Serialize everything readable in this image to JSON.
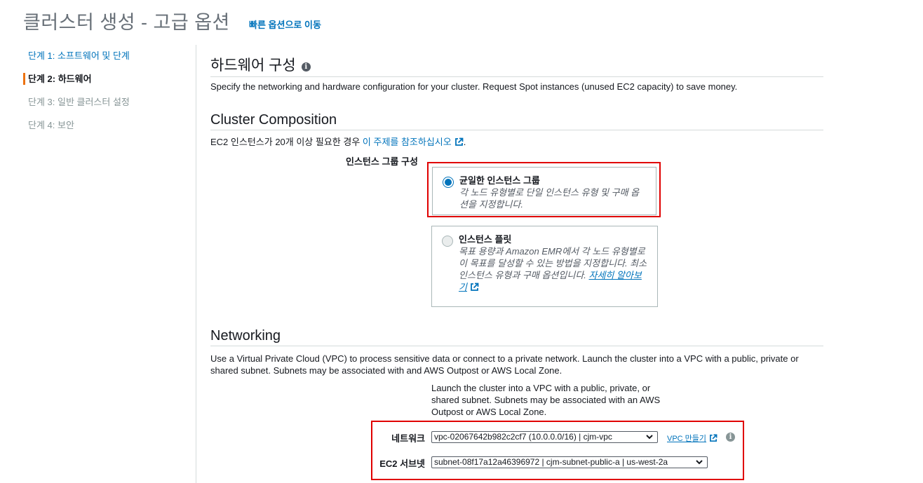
{
  "header": {
    "title": "클러스터 생성 - 고급 옵션",
    "quick_options_link": "빠른 옵션으로 이동"
  },
  "steps": [
    {
      "label": "단계 1: 소프트웨어 및 단계",
      "state": "link"
    },
    {
      "label": "단계 2: 하드웨어",
      "state": "active"
    },
    {
      "label": "단계 3: 일반 클러스터 설정",
      "state": "disabled"
    },
    {
      "label": "단계 4: 보안",
      "state": "disabled"
    }
  ],
  "hardware": {
    "title": "하드웨어 구성",
    "description": "Specify the networking and hardware configuration for your cluster. Request Spot instances (unused EC2 capacity) to save money."
  },
  "cluster_composition": {
    "title": "Cluster Composition",
    "note_prefix": "EC2 인스턴스가 20개 이상 필요한 경우 ",
    "note_link": "이 주제를 참조하십시오",
    "note_suffix": ".",
    "group_label": "인스턴스 그룹 구성",
    "options": [
      {
        "title": "균일한 인스턴스 그룹",
        "description": "각 노드 유형별로 단일 인스턴스 유형 및 구매 옵션을 지정합니다.",
        "selected": true
      },
      {
        "title": "인스턴스 플릿",
        "description": "목표 용량과 Amazon EMR에서 각 노드 유형별로 이 목표를 달성할 수 있는 방법을 지정합니다. 최소 인스턴스 유형과 구매 옵션입니다. ",
        "link": "자세히 알아보기",
        "selected": false
      }
    ]
  },
  "networking": {
    "title": "Networking",
    "description": "Use a Virtual Private Cloud (VPC) to process sensitive data or connect to a private network. Launch the cluster into a VPC with a public, private or shared subnet. Subnets may be associated with and AWS Outpost or AWS Local Zone.",
    "note": "Launch the cluster into a VPC with a public, private, or shared subnet. Subnets may be associated with an AWS Outpost or AWS Local Zone.",
    "network_label": "네트워크",
    "network_value": "vpc-02067642b982c2cf7 (10.0.0.0/16) | cjm-vpc",
    "create_vpc_link": "VPC 만들기",
    "subnet_label": "EC2 서브넷",
    "subnet_value": "subnet-08f17a12a46396972 | cjm-subnet-public-a | us-west-2a"
  },
  "colors": {
    "link": "#0073bb",
    "active_step_bar": "#ec7211",
    "highlight_box": "#e00000"
  }
}
